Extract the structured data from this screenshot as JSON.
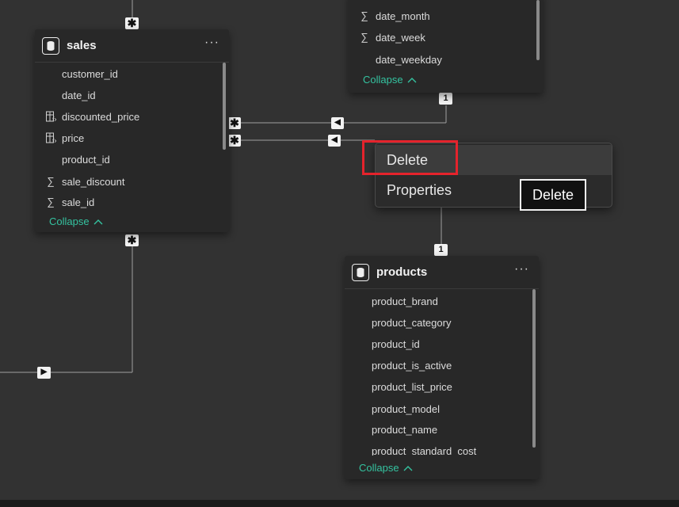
{
  "tables": {
    "date": {
      "fields": [
        {
          "name": "date_month",
          "icon": "sum"
        },
        {
          "name": "date_week",
          "icon": "sum"
        },
        {
          "name": "date_weekday",
          "icon": ""
        }
      ],
      "collapse_label": "Collapse"
    },
    "sales": {
      "title": "sales",
      "more_label": "···",
      "fields": [
        {
          "name": "customer_id",
          "icon": ""
        },
        {
          "name": "date_id",
          "icon": ""
        },
        {
          "name": "discounted_price",
          "icon": "calc"
        },
        {
          "name": "price",
          "icon": "calc"
        },
        {
          "name": "product_id",
          "icon": ""
        },
        {
          "name": "sale_discount",
          "icon": "sum"
        },
        {
          "name": "sale_id",
          "icon": "sum"
        }
      ],
      "collapse_label": "Collapse"
    },
    "products": {
      "title": "products",
      "more_label": "···",
      "fields": [
        {
          "name": "product_brand",
          "icon": ""
        },
        {
          "name": "product_category",
          "icon": ""
        },
        {
          "name": "product_id",
          "icon": ""
        },
        {
          "name": "product_is_active",
          "icon": ""
        },
        {
          "name": "product_list_price",
          "icon": ""
        },
        {
          "name": "product_model",
          "icon": ""
        },
        {
          "name": "product_name",
          "icon": ""
        },
        {
          "name": "product_standard_cost",
          "icon": ""
        }
      ],
      "collapse_label": "Collapse"
    }
  },
  "relationships": {
    "many_symbol": "✱",
    "one_symbol": "1",
    "arrow_left": "◀",
    "arrow_right": "▶"
  },
  "context_menu": {
    "items": [
      "Delete",
      "Properties"
    ]
  },
  "tooltip": {
    "text": "Delete"
  },
  "icons": {
    "sum": "∑",
    "calc": "calculated-column-icon",
    "collapse_chevron": "^"
  },
  "colors": {
    "canvas": "#323232",
    "card": "#282828",
    "collapse_link": "#34c3a0",
    "highlight": "#e5232c"
  }
}
